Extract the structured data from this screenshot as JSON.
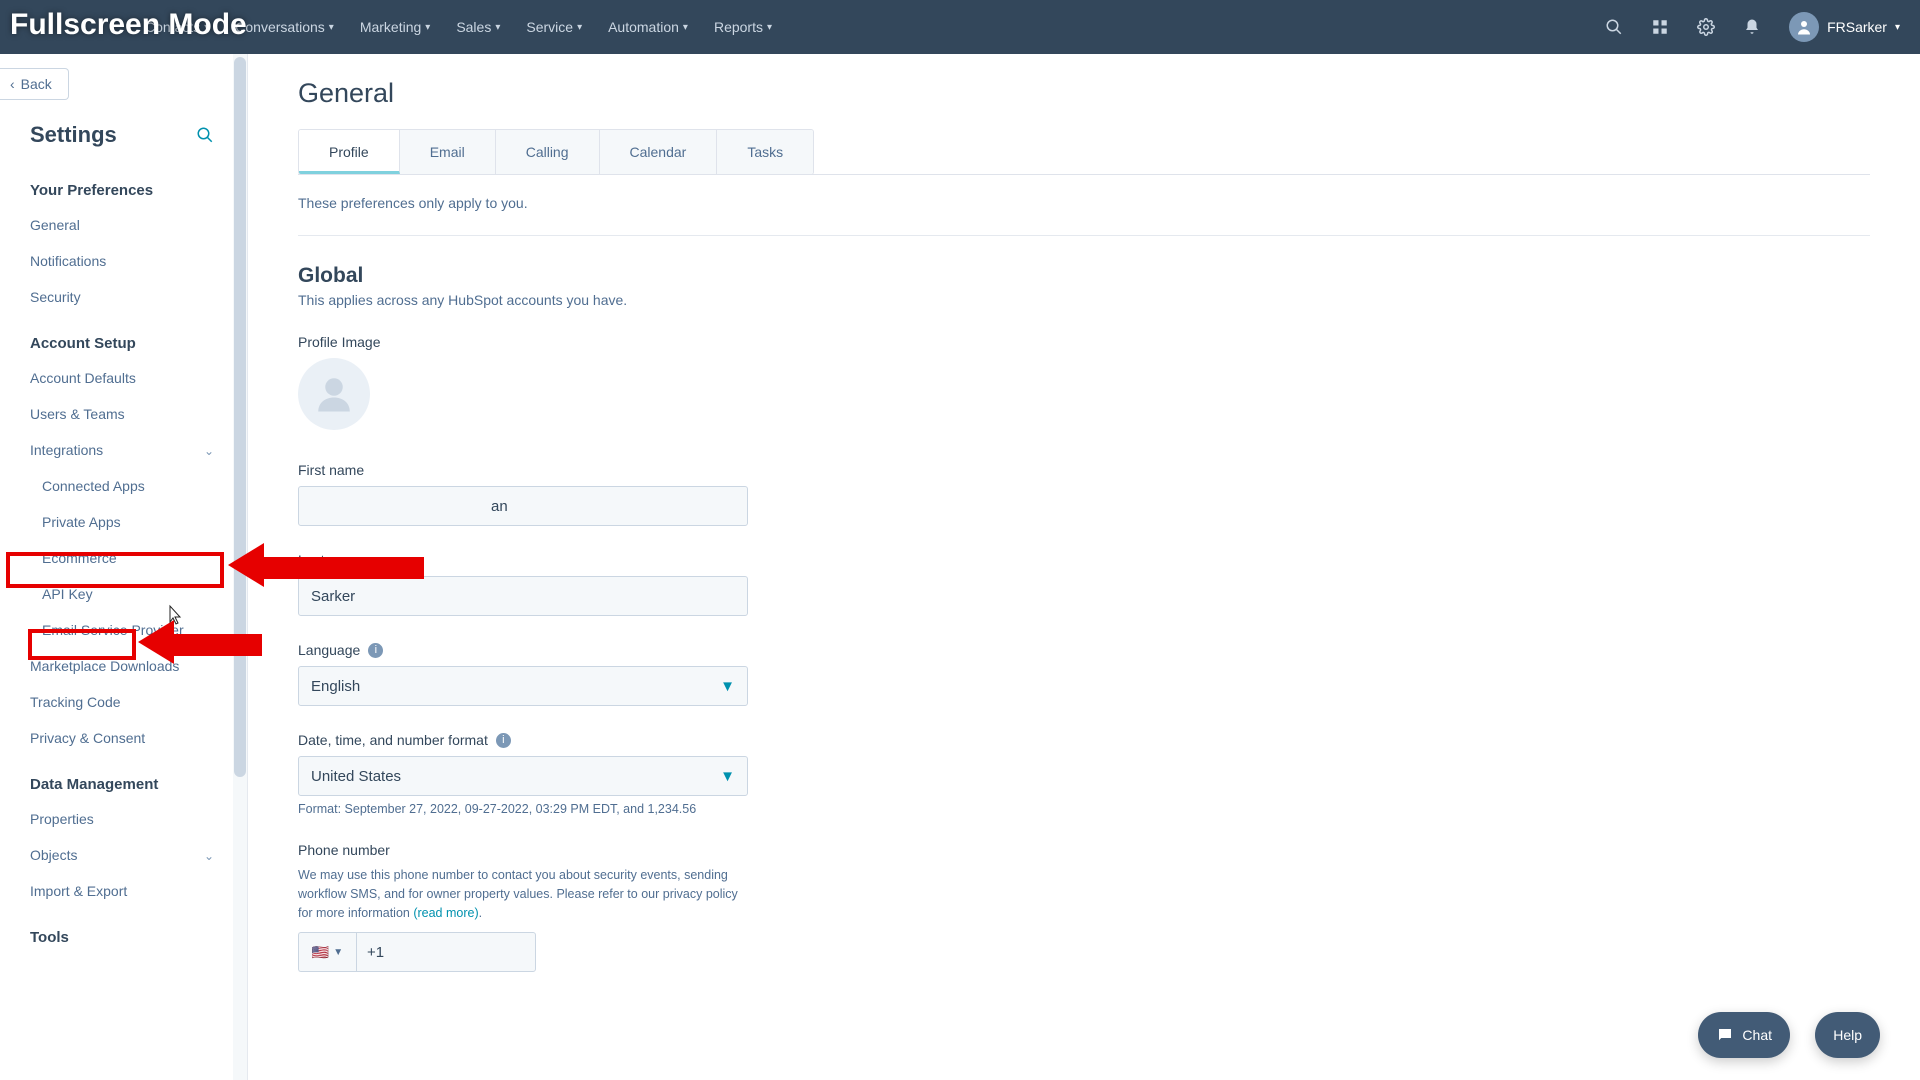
{
  "overlay": {
    "fullscreen": "Fullscreen Mode"
  },
  "topnav": {
    "items": [
      "Contacts",
      "Conversations",
      "Marketing",
      "Sales",
      "Service",
      "Automation",
      "Reports"
    ],
    "user": "FRSarker"
  },
  "sidebar": {
    "back": "Back",
    "title": "Settings",
    "prefs_header": "Your Preferences",
    "prefs": [
      "General",
      "Notifications",
      "Security"
    ],
    "account_header": "Account Setup",
    "account": {
      "defaults": "Account Defaults",
      "users": "Users & Teams",
      "integrations": "Integrations",
      "connected": "Connected Apps",
      "private": "Private Apps",
      "ecommerce": "Ecommerce",
      "apikey": "API Key",
      "esp": "Email Service Provider",
      "marketplace": "Marketplace Downloads",
      "tracking": "Tracking Code",
      "privacy": "Privacy & Consent"
    },
    "data_header": "Data Management",
    "data": {
      "properties": "Properties",
      "objects": "Objects",
      "import": "Import & Export"
    },
    "tools_header": "Tools"
  },
  "main": {
    "page_title": "General",
    "tabs": [
      "Profile",
      "Email",
      "Calling",
      "Calendar",
      "Tasks"
    ],
    "note": "These preferences only apply to you.",
    "global_h": "Global",
    "global_sub": "This applies across any HubSpot accounts you have.",
    "labels": {
      "profile_img": "Profile Image",
      "first": "First name",
      "last": "Last name",
      "lang": "Language",
      "date_fmt": "Date, time, and number format",
      "phone": "Phone number"
    },
    "values": {
      "first": "an",
      "last": "Sarker",
      "lang": "English",
      "date": "United States",
      "phone_prefix": "+1"
    },
    "format_example": "Format: September 27, 2022, 09-27-2022, 03:29 PM EDT, and 1,234.56",
    "phone_desc": "We may use this phone number to contact you about security events, sending workflow SMS, and for owner property values. Please refer to our privacy policy for more information ",
    "read_more": "(read more)",
    "period": "."
  },
  "widgets": {
    "chat": "Chat",
    "help": "Help"
  }
}
